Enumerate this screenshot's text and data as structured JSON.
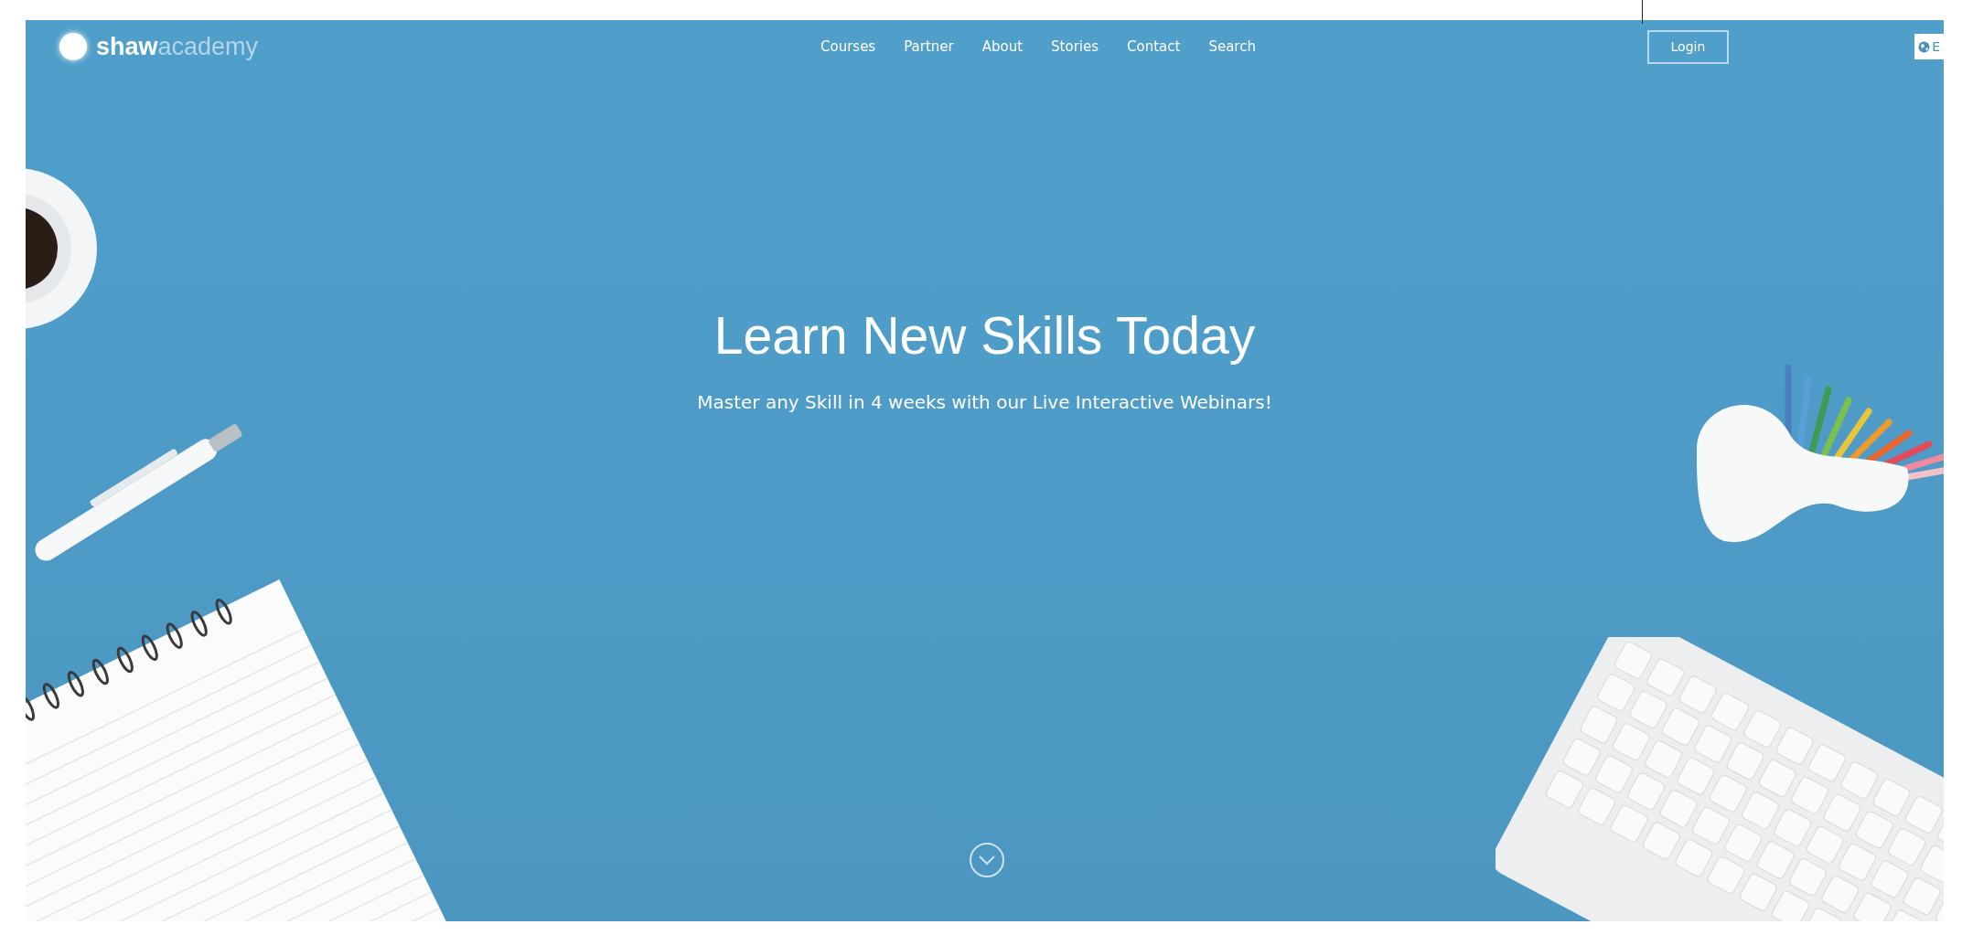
{
  "header": {
    "logo": "**shaw**academy",
    "nav": [
      {
        "label": "Courses"
      },
      {
        "label": "Partner"
      },
      {
        "label": "About"
      },
      {
        "label": "Stories"
      },
      {
        "label": "Contact"
      },
      {
        "label": "Search"
      }
    ],
    "login": "Login",
    "language": "E"
  },
  "hero": {
    "title": "Learn New Skills Today",
    "subtitle": "Master any Skill in 4 weeks with our Live Interactive Webinars!"
  }
}
